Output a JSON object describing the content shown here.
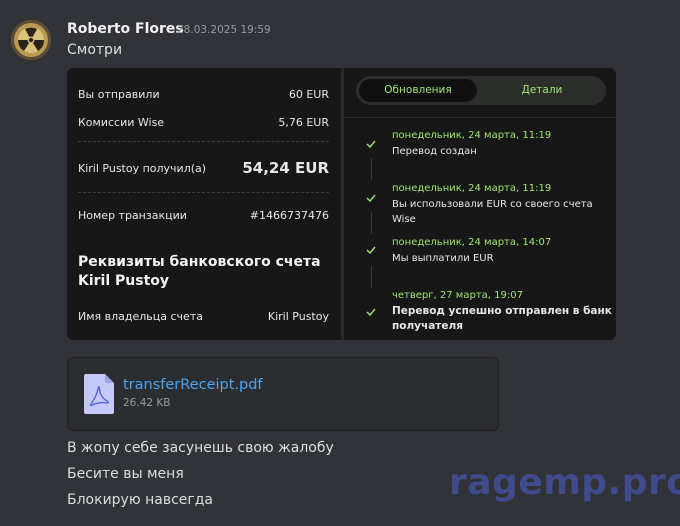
{
  "message": {
    "author": "Roberto Flores",
    "timestamp": "28.03.2025 19:59",
    "text_1": "Смотри",
    "text_2": "В жопу себе засунешь свою жалобу",
    "text_3": "Бесите вы меня",
    "text_4": "Блокирую навсегда"
  },
  "screenshot": {
    "left": {
      "sent_label": "Вы отправили",
      "sent_value": "60 EUR",
      "fee_label": "Комиссии Wise",
      "fee_value": "5,76 EUR",
      "received_label": "Kiril Pustoy получил(а)",
      "received_value": "54,24 EUR",
      "txn_label": "Номер транзакции",
      "txn_value": "#1466737476",
      "bank_title": "Реквизиты банковского счета Kiril Pustoy",
      "holder_label": "Имя владельца счета",
      "holder_value": "Kiril Pustoy"
    },
    "right": {
      "tab_updates": "Обновления",
      "tab_details": "Детали",
      "events": [
        {
          "date": "понедельник, 24 марта, 11:19",
          "text": "Перевод создан"
        },
        {
          "date": "понедельник, 24 марта, 11:19",
          "text": "Вы использовали EUR со своего счета Wise"
        },
        {
          "date": "понедельник, 24 марта, 14:07",
          "text": "Мы выплатили EUR"
        },
        {
          "date": "четверг, 27 марта, 19:07",
          "text": "Перевод успешно отправлен в банк получателя"
        }
      ]
    }
  },
  "attachment": {
    "filename": "transferReceipt.pdf",
    "size": "26.42 KB",
    "icon": "pdf-file-icon"
  },
  "watermark": "ragemp.pro",
  "colors": {
    "background": "#323339",
    "accent_green": "#9fe870",
    "link_blue": "#4aa5f0"
  }
}
